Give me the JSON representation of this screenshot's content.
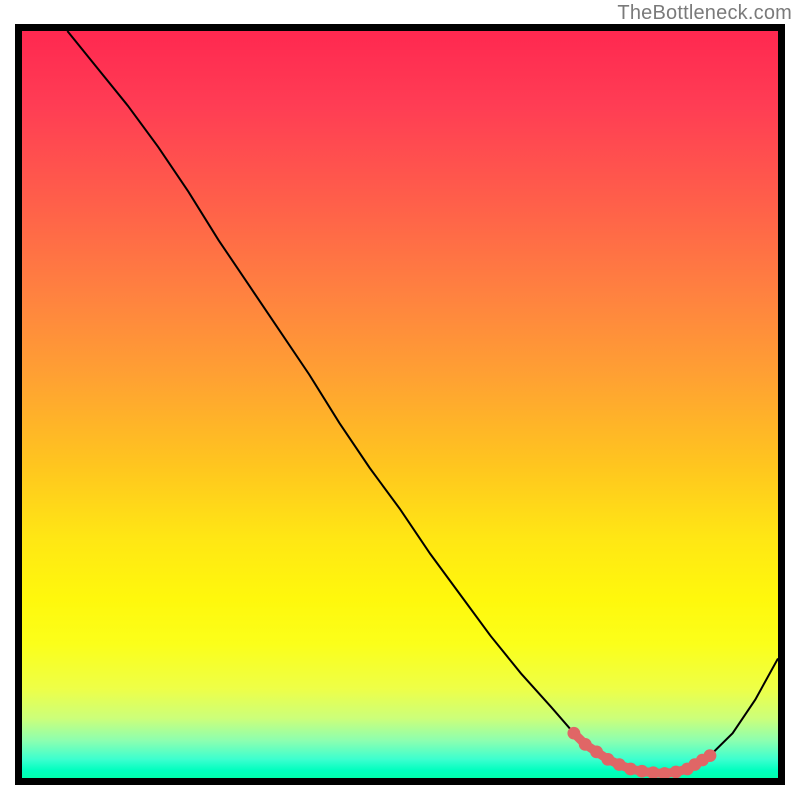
{
  "watermark": "TheBottleneck.com",
  "chart_data": {
    "type": "line",
    "title": "",
    "xlabel": "",
    "ylabel": "",
    "xlim": [
      0,
      100
    ],
    "ylim": [
      0,
      100
    ],
    "grid": false,
    "legend": false,
    "series": [
      {
        "name": "bottleneck-curve",
        "color": "#000000",
        "x": [
          6,
          10,
          14,
          18,
          22,
          26,
          30,
          34,
          38,
          42,
          46,
          50,
          54,
          58,
          62,
          66,
          70,
          73,
          76,
          79,
          82,
          85,
          88,
          91,
          94,
          97,
          100
        ],
        "y": [
          100,
          95,
          90,
          84.5,
          78.5,
          72,
          66,
          60,
          54,
          47.5,
          41.5,
          36,
          30,
          24.5,
          19,
          14,
          9.5,
          6,
          3.5,
          1.8,
          0.9,
          0.6,
          1.2,
          3,
          6,
          10.5,
          16
        ]
      },
      {
        "name": "optimal-range-markers",
        "color": "#e06666",
        "type": "scatter",
        "x": [
          73,
          74.5,
          76,
          77.5,
          79,
          80.5,
          82,
          83.5,
          85,
          86.5,
          88,
          89,
          90,
          91
        ],
        "y": [
          6,
          4.5,
          3.5,
          2.5,
          1.8,
          1.2,
          0.9,
          0.7,
          0.6,
          0.8,
          1.2,
          1.8,
          2.4,
          3
        ]
      }
    ],
    "colors": {
      "gradient_top": "#ff2850",
      "gradient_mid": "#ffe714",
      "gradient_bottom": "#00ffad",
      "curve": "#000000",
      "markers": "#e06666"
    }
  }
}
